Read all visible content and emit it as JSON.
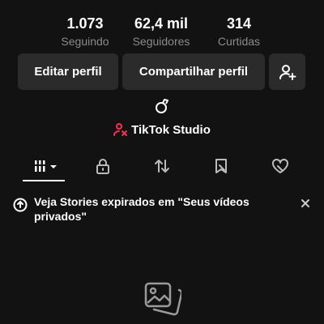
{
  "stats": [
    {
      "value": "1.073",
      "label": "Seguindo"
    },
    {
      "value": "62,4 mil",
      "label": "Seguidores"
    },
    {
      "value": "314",
      "label": "Curtidas"
    }
  ],
  "actions": {
    "edit_label": "Editar perfil",
    "share_label": "Compartilhar perfil",
    "add_friend_icon": "add-user-icon"
  },
  "studio": {
    "label": "TikTok Studio",
    "icon": "tiktok-studio-icon",
    "icon_color": "#fe2c55"
  },
  "tabs": [
    {
      "icon": "grid-icon",
      "active": true
    },
    {
      "icon": "lock-icon",
      "active": false
    },
    {
      "icon": "repost-icon",
      "active": false
    },
    {
      "icon": "bookmark-icon",
      "active": false
    },
    {
      "icon": "liked-icon",
      "active": false
    }
  ],
  "notice": {
    "text": "Veja Stories expirados em \"Seus vídeos privados\""
  },
  "colors": {
    "background": "#121212",
    "button_bg": "#2b2b2b",
    "muted_text": "#8a8a8a",
    "accent": "#fe2c55"
  }
}
